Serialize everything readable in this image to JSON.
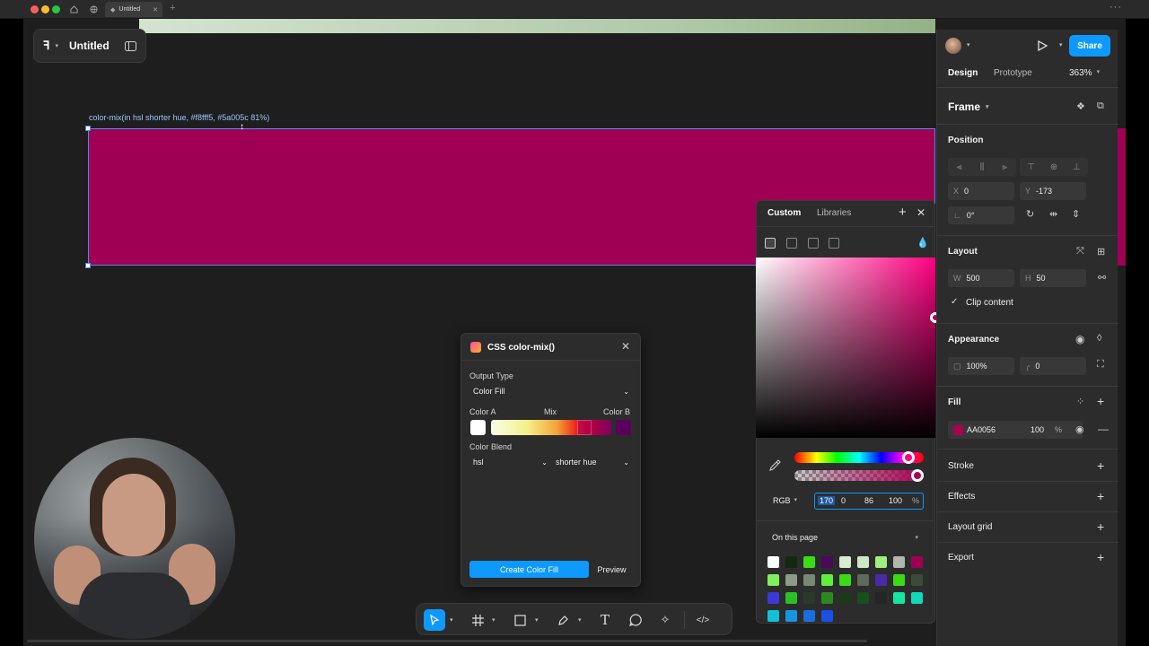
{
  "browser": {
    "tab_title": "Untitled"
  },
  "file": {
    "name": "Untitled"
  },
  "canvas": {
    "frame_label": "color-mix(in hsl shorter hue, #f8fff5, #5a005c 81%)",
    "frame_color": "#AA0056"
  },
  "plugin": {
    "title": "CSS color-mix()",
    "output_type_label": "Output Type",
    "output_type_value": "Color Fill",
    "color_a_label": "Color A",
    "mix_label": "Mix",
    "color_b_label": "Color B",
    "color_blend_label": "Color Blend",
    "blend_space": "hsl",
    "hue_method": "shorter hue",
    "create_button": "Create Color Fill",
    "preview_button": "Preview",
    "color_a": "#ffffff",
    "color_b": "#5a005c",
    "mix_percent": 81
  },
  "picker": {
    "tab_custom": "Custom",
    "tab_libraries": "Libraries",
    "mode": "RGB",
    "r": "170",
    "g": "0",
    "b": "86",
    "alpha": "100",
    "percent_sign": "%",
    "swatch_source": "On this page",
    "swatches": [
      "#ffffff",
      "#0f2a0f",
      "#3cdc14",
      "#4a0a5a",
      "#d8ecd2",
      "#cfe8c4",
      "#9fef7e",
      "#b0b8ad",
      "#a00054",
      "#7fef5e",
      "#8c9a88",
      "#778873",
      "#5fef3e",
      "#3cdc14",
      "#5e6a5a",
      "#4b2aa8",
      "#3cdc14",
      "#3c4a38",
      "#3a3ad8",
      "#2cc028",
      "#2a3a28",
      "#2a8a20",
      "#1a3a18",
      "#17501a",
      "#262626",
      "#14e6a0",
      "#10d8b8",
      "#14c0d8",
      "#1496e0",
      "#1a6ee0",
      "#1a50e8"
    ]
  },
  "panel": {
    "tab_design": "Design",
    "tab_prototype": "Prototype",
    "zoom": "363%",
    "share_button": "Share",
    "frame_title": "Frame",
    "position_title": "Position",
    "x_label": "X",
    "x_value": "0",
    "y_label": "Y",
    "y_value": "-173",
    "rotation_value": "0°",
    "layout_title": "Layout",
    "w_label": "W",
    "w_value": "500",
    "h_label": "H",
    "h_value": "50",
    "clip_content": "Clip content",
    "appearance_title": "Appearance",
    "opacity_value": "100%",
    "radius_value": "0",
    "fill_title": "Fill",
    "fill_hex": "AA0056",
    "fill_opacity": "100",
    "fill_pct": "%",
    "stroke_title": "Stroke",
    "effects_title": "Effects",
    "layout_grid_title": "Layout grid",
    "export_title": "Export"
  }
}
